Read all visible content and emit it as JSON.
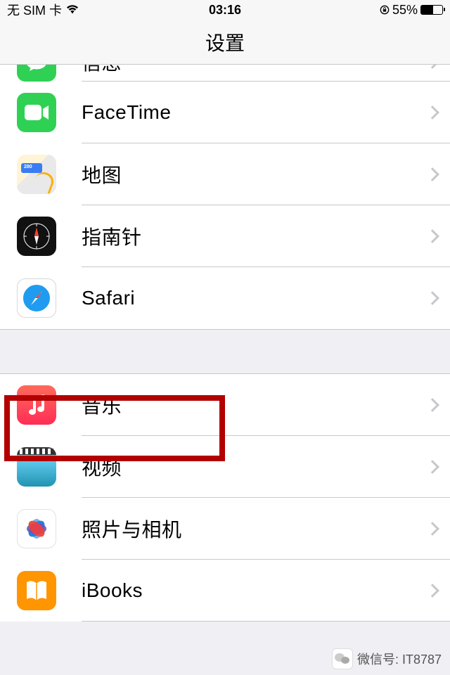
{
  "status": {
    "carrier": "无 SIM 卡",
    "time": "03:16",
    "battery": "55%"
  },
  "nav": {
    "title": "设置"
  },
  "group1": [
    {
      "label": "信息"
    },
    {
      "label": "FaceTime"
    },
    {
      "label": "地图"
    },
    {
      "label": "指南针"
    },
    {
      "label": "Safari"
    }
  ],
  "group2": [
    {
      "label": "音乐"
    },
    {
      "label": "视频"
    },
    {
      "label": "照片与相机"
    },
    {
      "label": "iBooks"
    }
  ],
  "watermark": {
    "text": "微信号: IT8787"
  }
}
